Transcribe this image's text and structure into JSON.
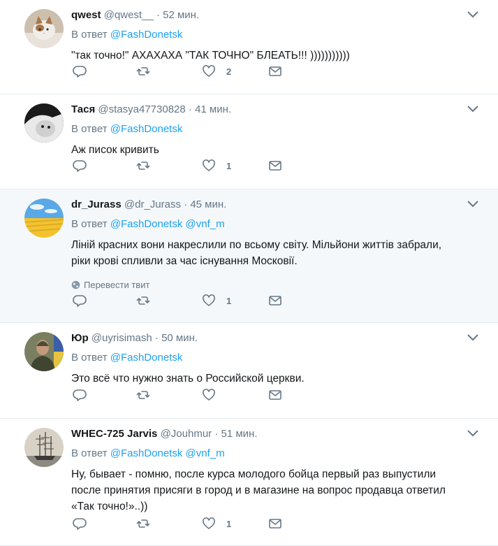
{
  "tweets": [
    {
      "fullname": "qwest",
      "username": "@qwest__",
      "time": "52 мин.",
      "replying_prefix": "В ответ",
      "mentions": [
        "@FashDonetsk"
      ],
      "text_lines": [
        "\"так точно!\" АХАХАХА \"ТАК ТОЧНО\" БЛЕАТЬ!!! )))))))))))"
      ],
      "translate": "",
      "like_count": "2",
      "avatar": "cat-avatar"
    },
    {
      "fullname": "Тася",
      "username": "@stasya47730828",
      "time": "41 мин.",
      "replying_prefix": "В ответ",
      "mentions": [
        "@FashDonetsk"
      ],
      "text_lines": [
        "Аж писок кривить"
      ],
      "translate": "",
      "like_count": "1",
      "avatar": "bw-cat-avatar"
    },
    {
      "fullname": "dr_Jurass",
      "username": "@dr_Jurass",
      "time": "45 мин.",
      "replying_prefix": "В ответ",
      "mentions": [
        "@FashDonetsk",
        "@vnf_m"
      ],
      "text_lines": [
        "Ліній красних вони накреслили по всьому світу. Мільйони життів забрали,",
        "ріки крові спливли за час існування Московії."
      ],
      "translate": "Перевести твит",
      "like_count": "1",
      "avatar": "wheat-field-avatar"
    },
    {
      "fullname": "Юр",
      "username": "@uyrisimash",
      "time": "50 мин.",
      "replying_prefix": "В ответ",
      "mentions": [
        "@FashDonetsk"
      ],
      "text_lines": [
        "Это всё что нужно знать о Российской церкви."
      ],
      "translate": "",
      "like_count": "",
      "avatar": "soldier-avatar"
    },
    {
      "fullname": "WHEC-725 Jarvis",
      "username": "@Jouhmur",
      "time": "51 мин.",
      "replying_prefix": "В ответ",
      "mentions": [
        "@FashDonetsk",
        "@vnf_m"
      ],
      "text_lines": [
        "Ну, бывает -  помню, после курса молодого бойца первый раз выпустили",
        "после принятия присяги в город и в магазине на вопрос продавца ответил",
        "«Так точно!»..))"
      ],
      "translate": "",
      "like_count": "1",
      "avatar": "sailing-ship-avatar"
    }
  ],
  "colors": {
    "link": "#1da1f2",
    "muted": "#657786",
    "text": "#14171a",
    "highlight_bg": "#f5f8fa",
    "divider": "#e6ecf0"
  }
}
